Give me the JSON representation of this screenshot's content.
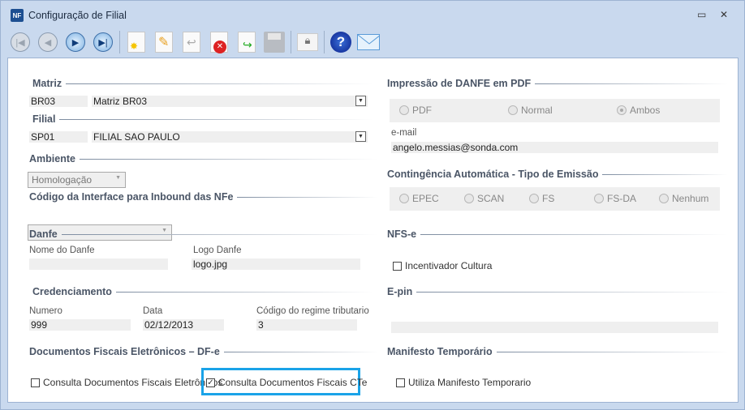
{
  "window": {
    "title": "Configuração de Filial",
    "icon_text": "NF"
  },
  "toolbar": [
    "first-icon",
    "previous-icon",
    "next-icon",
    "last-icon",
    "new-icon",
    "edit-icon",
    "undo-icon",
    "delete-icon",
    "export-icon",
    "save-icon",
    "lock-icon",
    "help-icon",
    "email-icon"
  ],
  "matriz": {
    "title": "Matriz",
    "code": "BR03",
    "name": "Matriz BR03"
  },
  "filial": {
    "title": "Filial",
    "code": "SP01",
    "name": "FILIAL SAO PAULO"
  },
  "ambiente": {
    "title": "Ambiente",
    "value": "Homologação"
  },
  "interface": {
    "title": "Código da Interface para Inbound das NFe",
    "value": ""
  },
  "danfe": {
    "title": "Danfe",
    "nome_label": "Nome do Danfe",
    "nome_value": "",
    "logo_label": "Logo Danfe",
    "logo_value": "logo.jpg"
  },
  "cred": {
    "title": "Credenciamento",
    "numero_label": "Numero",
    "numero": "999",
    "data_label": "Data",
    "data": "02/12/2013",
    "regime_label": "Código do regime tributario",
    "regime": "3"
  },
  "dfe": {
    "title": "Documentos Fiscais Eletrônicos – DF-e",
    "opt1": "Consulta Documentos Fiscais Eletrônicos",
    "opt1_checked": false,
    "opt2": "Consulta Documentos Fiscais CTe",
    "opt2_checked": true
  },
  "impressao": {
    "title": "Impressão de DANFE em PDF",
    "options": [
      "PDF",
      "Normal",
      "Ambos"
    ],
    "selected": "Ambos",
    "email_label": "e-mail",
    "email": "angelo.messias@sonda.com"
  },
  "contingencia": {
    "title": "Contingência Automática - Tipo de Emissão",
    "options": [
      "EPEC",
      "SCAN",
      "FS",
      "FS-DA",
      "Nenhum"
    ]
  },
  "nfse": {
    "title": "NFS-e",
    "opt": "Incentivador Cultura",
    "checked": false
  },
  "epin": {
    "title": "E-pin",
    "value": ""
  },
  "manifesto": {
    "title": "Manifesto Temporário",
    "opt": "Utiliza Manifesto Temporario",
    "checked": false
  },
  "colors": {
    "highlight": "#1aa3e8"
  }
}
